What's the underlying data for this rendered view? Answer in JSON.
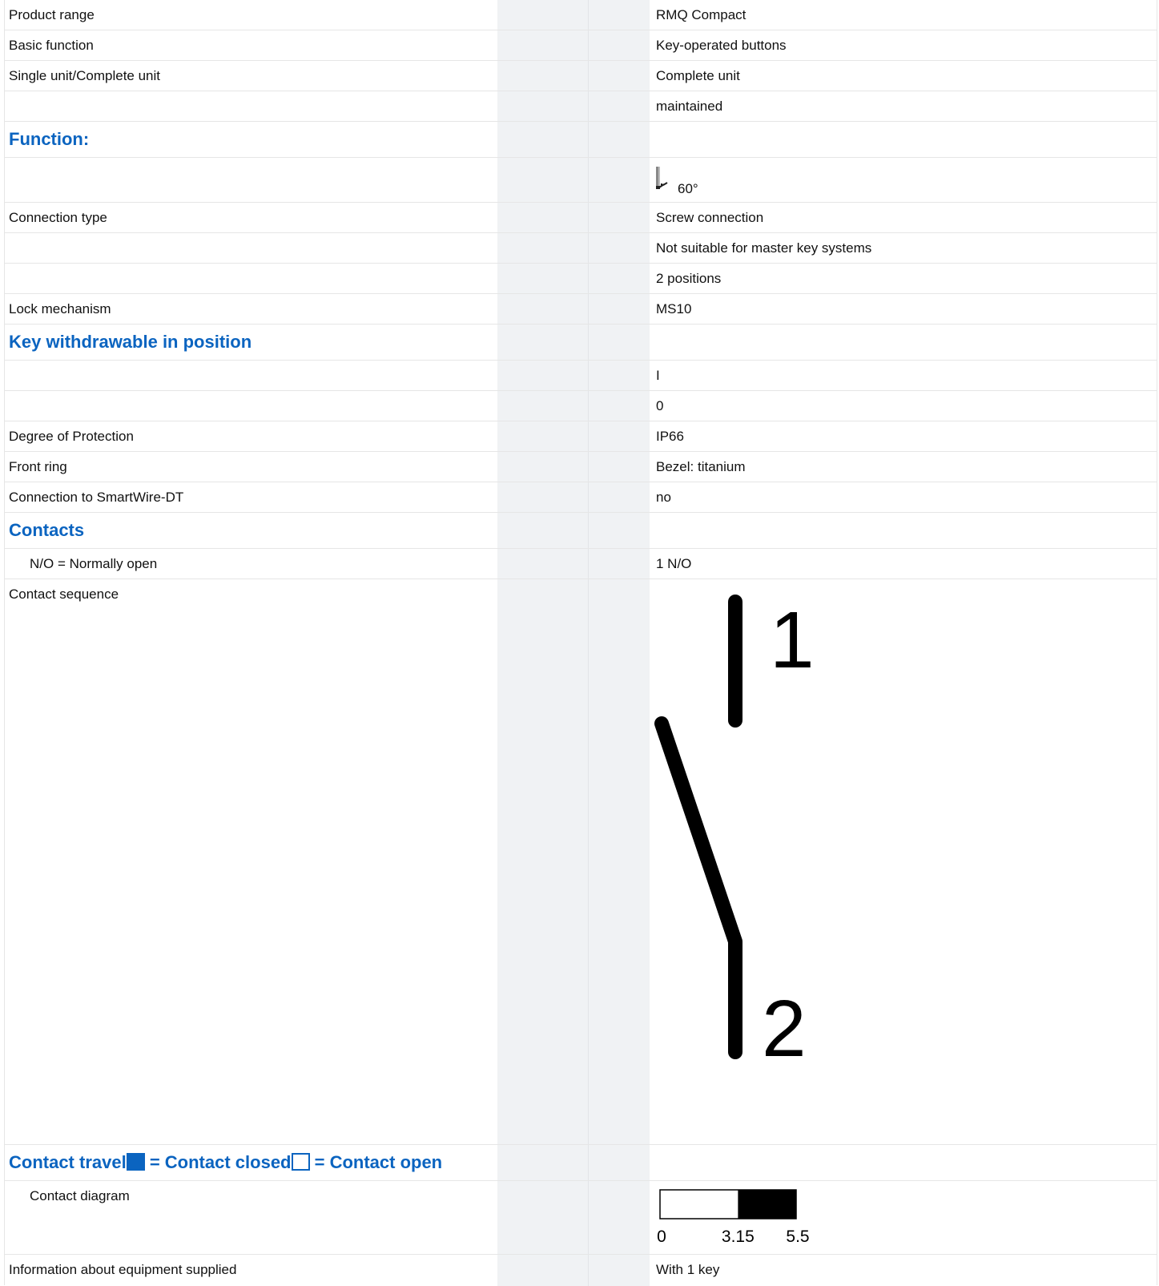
{
  "rows": {
    "product_range": {
      "label": "Product range",
      "value": "RMQ Compact"
    },
    "basic_function": {
      "label": "Basic function",
      "value": "Key-operated buttons"
    },
    "single_complete": {
      "label": "Single unit/Complete unit",
      "value": "Complete unit"
    },
    "maintained": {
      "value": "maintained"
    },
    "function_head": {
      "label": "Function:"
    },
    "angle": {
      "value": "60°"
    },
    "connection_type": {
      "label": "Connection type",
      "value": "Screw connection"
    },
    "master_key": {
      "value": "Not suitable for master key systems"
    },
    "positions": {
      "value": "2 positions"
    },
    "lock_mechanism": {
      "label": "Lock mechanism",
      "value": "MS10"
    },
    "key_withdrawable_head": {
      "label": "Key withdrawable in position"
    },
    "key_pos_1": {
      "value": "I"
    },
    "key_pos_2": {
      "value": "0"
    },
    "degree_protection": {
      "label": "Degree of Protection",
      "value": "IP66"
    },
    "front_ring": {
      "label": "Front ring",
      "value": "Bezel: titanium"
    },
    "smartwire": {
      "label": "Connection to SmartWire-DT",
      "value": "no"
    },
    "contacts_head": {
      "label": "Contacts"
    },
    "no_contacts": {
      "label": "N/O = Normally open",
      "value": "1 N/O"
    },
    "contact_sequence": {
      "label": "Contact sequence",
      "terminal_1": "1",
      "terminal_2": "2"
    },
    "contact_travel_head": {
      "label_a": "Contact travel",
      "label_b": " = Contact closed",
      "label_c": " = Contact open"
    },
    "contact_diagram": {
      "label": "Contact diagram",
      "scale": [
        "0",
        "3.15",
        "5.5"
      ],
      "closed_from": 3.15,
      "closed_to": 5.5,
      "max": 5.5
    },
    "equipment_supplied": {
      "label": "Information about equipment supplied",
      "value": "With 1 key"
    }
  },
  "colors": {
    "accent": "#0b64c0",
    "shade": "#f0f2f4",
    "border": "#e6e6e6"
  },
  "icons": [
    "key-switch-function-icon",
    "contact-sequence-symbol"
  ]
}
